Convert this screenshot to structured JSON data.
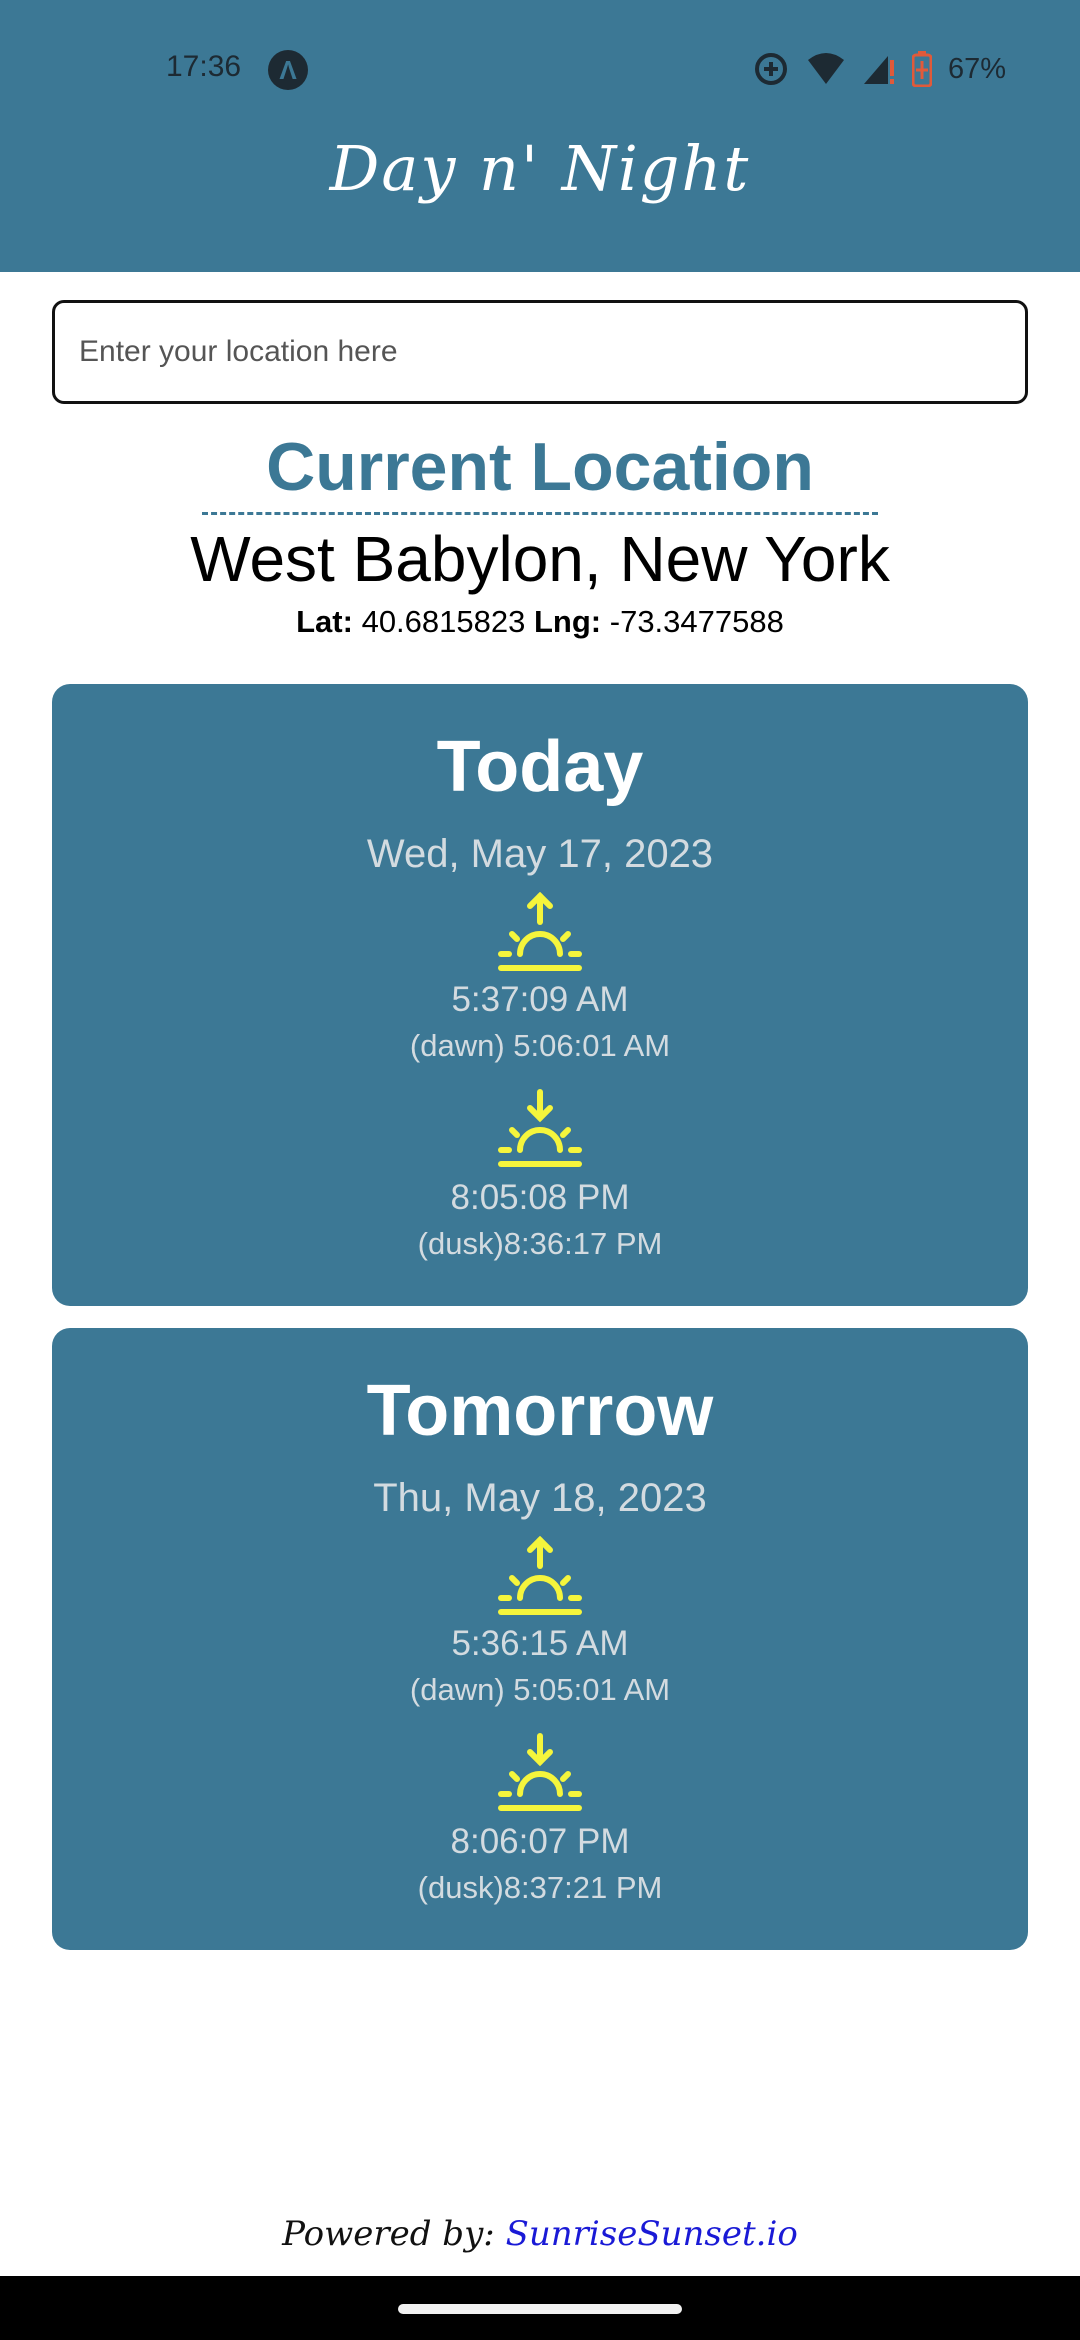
{
  "status_bar": {
    "time": "17:36",
    "battery": "67%",
    "icons": [
      "app-notification-icon",
      "data-saver-icon",
      "wifi-icon",
      "cell-signal-icon",
      "battery-icon"
    ]
  },
  "header": {
    "title": "Day n' Night"
  },
  "search": {
    "placeholder": "Enter your location here",
    "value": ""
  },
  "location": {
    "heading": "Current Location",
    "name": "West Babylon, New York",
    "lat_label": "Lat:",
    "lat": "40.6815823",
    "lng_label": "Lng:",
    "lng": "-73.3477588"
  },
  "days": [
    {
      "title": "Today",
      "date": "Wed, May 17, 2023",
      "sunrise": "5:37:09 AM",
      "dawn": "(dawn) 5:06:01 AM",
      "sunset": "8:05:08 PM",
      "dusk": "(dusk)8:36:17 PM"
    },
    {
      "title": "Tomorrow",
      "date": "Thu, May 18, 2023",
      "sunrise": "5:36:15 AM",
      "dawn": "(dawn) 5:05:01 AM",
      "sunset": "8:06:07 PM",
      "dusk": "(dusk)8:37:21 PM"
    }
  ],
  "footer": {
    "prefix": "Powered by:",
    "link": "SunriseSunset.io"
  },
  "colors": {
    "primary": "#3c7895",
    "sun_icon": "#f5f53c",
    "link": "#1a1ad6"
  }
}
